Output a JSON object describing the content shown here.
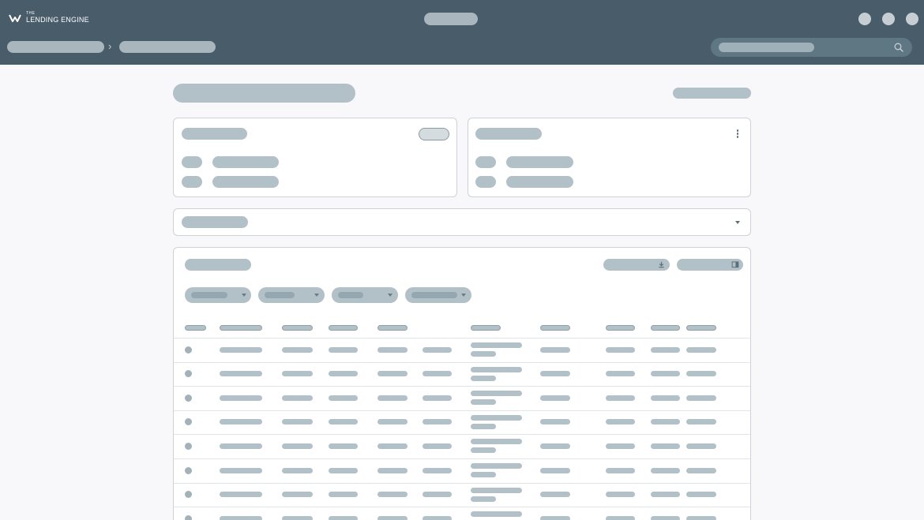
{
  "app": {
    "logo_small": "THE",
    "logo_big": "LENDING ENGINE"
  },
  "colors": {
    "header_bg": "#485c69",
    "skeleton": "#b2c0c7",
    "page_bg": "#f8f8fb"
  },
  "icons": {
    "logo": "lending-engine-logo-icon",
    "breadcrumb_separator": "chevron-right-icon",
    "search": "search-icon",
    "menu": "kebab-menu-icon",
    "dropdown": "caret-down-icon",
    "download": "download-icon",
    "panel": "panel-toggle-icon"
  },
  "breadcrumb": {
    "separator": "›"
  },
  "table": {
    "row_count": 8
  }
}
